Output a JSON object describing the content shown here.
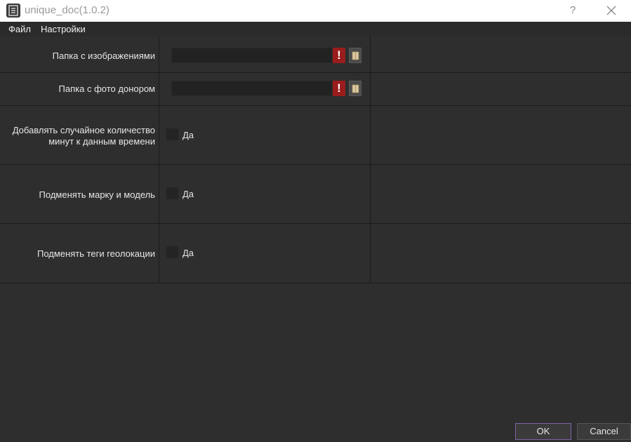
{
  "window": {
    "title": "unique_doc(1.0.2)",
    "help_label": "?"
  },
  "menu": {
    "items": [
      "Файл",
      "Настройки"
    ]
  },
  "form": {
    "images_folder_label": "Папка с изображениями",
    "images_folder_value": "",
    "donor_folder_label": "Папка с фото донором",
    "donor_folder_value": "",
    "warning_glyph": "!",
    "random_minutes_label_line1": "Добавлять случайное количество",
    "random_minutes_label_line2": "минут к данным времени",
    "random_minutes_checked": false,
    "replace_make_label": "Подменять марку и модель",
    "replace_make_checked": false,
    "replace_geo_label": "Подменять теги геолокации",
    "replace_geo_checked": false,
    "checkbox_text": "Да"
  },
  "buttons": {
    "ok": "OK",
    "cancel": "Cancel"
  },
  "colors": {
    "background": "#2e2e2e",
    "warning": "#9b1c1c",
    "ok_border": "#7d62a8"
  }
}
